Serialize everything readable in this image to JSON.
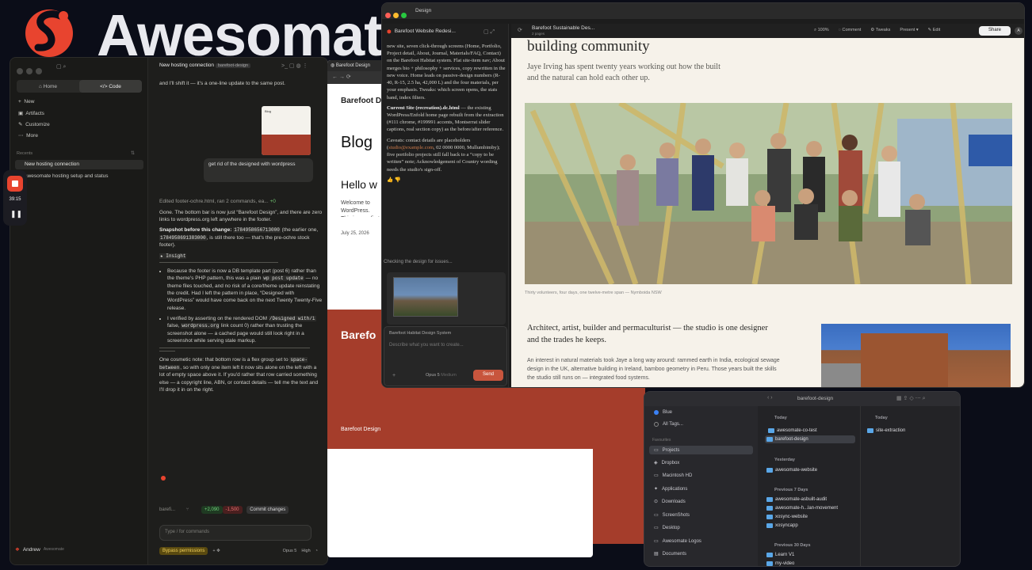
{
  "brand": {
    "logo_text": "Awesomat"
  },
  "claude": {
    "mode_tabs": [
      "Home",
      "Code"
    ],
    "nav": [
      "New",
      "Artifacts",
      "Customize",
      "More"
    ],
    "recents_label": "Recents",
    "recents": [
      "New hosting connection",
      "awesomate hosting setup and status"
    ],
    "title": "New hosting connection",
    "title_badge": "barefoot-design",
    "intro": "and I'll shift it — it's a one-line update to the same post.",
    "user_bubble": "get rid of the designed with wordpress",
    "action_line": "Edited footer-ochre.html, ran 2 commands, ea...",
    "action_plus": "+0",
    "gone_text": "Gone. The bottom bar is now just “Barefoot Design”, and there are zero links to wordpress.org left anywhere in the footer.",
    "snapshot_label": "Snapshot before this change:",
    "snapshot_id": "1784958656713000",
    "snapshot_mid": "(the earlier one,",
    "snapshot_id2": "1784958691383000",
    "snapshot_tail": ", is still there too — that's the pre-ochre stock footer).",
    "insight_label": "★ Insight",
    "bullet1a": "Because the footer is now a DB template part (post 6) rather than the theme's PHP pattern, this was a plain",
    "bullet1_code": "wp post update",
    "bullet1b": "— no theme files touched, and no risk of a core/theme update reinstating the credit. Had I left the pattern in place, “Designed with WordPress” would have come back on the next Twenty Twenty-Five release.",
    "bullet2a": "I verified by asserting on the rendered DOM",
    "bullet2_code1": "/Designed with/i",
    "bullet2b": "false,",
    "bullet2_code2": "wordpress.org",
    "bullet2c": "link count 0) rather than trusting the screenshot alone — a cached page would still look right in a screenshot while serving stale markup.",
    "cosmetic_a": "One cosmetic note: that bottom row is a flex group set to",
    "cosmetic_code": "space-between",
    "cosmetic_b": ", so with only one item left it now sits alone on the left with a lot of empty space above it. If you'd rather that row carried something else — a copyright line, ABN, or contact details — tell me the text and I'll drop it in on the right.",
    "branch": "barefi...",
    "diff_add": "+2,090",
    "diff_del": "-1,500",
    "commit_btn": "Commit changes",
    "input_placeholder": "Type / for commands",
    "bypass": "Bypass permissions",
    "model": "Opus 5",
    "effort": "High",
    "user_name": "Andrew",
    "user_plan": "Awesomate",
    "thumb_title": "Blog"
  },
  "recorder": {
    "time": "39:15"
  },
  "browser": {
    "tab": "Barefoot Design",
    "site_name": "Barefoot De",
    "heading": "Blog",
    "post_title": "Hello w",
    "post_excerpt": "Welcome to WordPress. This is your first post. Edit or delete it, then start writing!",
    "post_date": "July 25, 2026",
    "footer_brand": "Barefo",
    "footer_small": "Barefoot Design"
  },
  "design_app": {
    "window_title": "Design",
    "project_name": "Barefoot Website Redesi...",
    "file_name": "Barefoot Sustainable Des...",
    "file_sub": "2 pages",
    "zoom": "100%",
    "toolbar": [
      "Comment",
      "Tweaks",
      "Present",
      "Edit"
    ],
    "share": "Share",
    "avatar": "A",
    "left_text_1": "new site, seven click-through screens (Home, Portfolio, Project detail, About, Journal, Materials/FAQ, Contact) on the Barefoot Habitat system. Flat site-item nav; About merges bio + philosophy + services, copy rewritten in the new voice. Home leads on passive-design numbers (R-40, R-15, 2.5 ha, 42,000 L) and the four materials, per your emphasis. Tweaks: which screen opens, the stats band, index filters.",
    "left_bold_2": "Current Site (recreation).dc.html",
    "left_text_2": "— the existing WordPress/Enfold home page rebuilt from the extraction (#111 chrome, #199991 accents, Montserrat slider captions, real section copy) as the before/after reference.",
    "left_text_3a": "Caveats: contact details are placeholders (",
    "left_link": "studio@example.com",
    "left_text_3b": ", 02 0000 0000, Mullumbimby); five portfolio projects still fall back to a “copy to be written” note; Acknowledgement of Country wording needs the studio's sign-off.",
    "checking": "Checking the design for issues...",
    "system_label": "Barefoot Habitat Design System",
    "prompt_placeholder": "Describe what you want to create...",
    "model": "Opus 5",
    "model_sub": "Medium",
    "send": "Send",
    "canvas_heading": "building community",
    "canvas_intro": "Jaye Irving has spent twenty years working out how the built and the natural can hold each other up.",
    "photo_caption": "Thirty volunteers, four days, one twelve-metre span — Nymboida NSW",
    "section_heading": "Architect, artist, builder and permaculturist — the studio is one designer and the trades he keeps.",
    "section_body": "An interest in natural materials took Jaye a long way around: rammed earth in India, ecological sewage design in the UK, alternative building in Ireland, bamboo geometry in Peru. Those years built the skills the studio still runs on — integrated food systems."
  },
  "finder": {
    "path": "barefoot-design",
    "sidebar": [
      "Blue",
      "All Tags...",
      "Favourites",
      "Projects",
      "Dropbox",
      "Macintosh HD",
      "Applications",
      "Downloads",
      "ScreenShots",
      "Desktop",
      "Awesomate Logos",
      "Documents"
    ],
    "col1_today_label": "Today",
    "col1_today": [
      "awesomate-co-test",
      "barefoot-design"
    ],
    "col1_yesterday_label": "Yesterday",
    "col1_yesterday": [
      "awesomate-website"
    ],
    "col1_prev7_label": "Previous 7 Days",
    "col1_prev7": [
      "awesomate-asbuilt-audit",
      "awesomate-h...lan-movement",
      "xosync-website",
      "xosyncapp"
    ],
    "col1_prev30_label": "Previous 30 Days",
    "col1_prev30": [
      "Learn V1",
      "my-video"
    ],
    "col2_today_label": "Today",
    "col2_today": [
      "site-extraction"
    ]
  },
  "colors": {
    "rust": "#a53d2b",
    "accent": "#cc7a4a",
    "logo": "#e8442f",
    "folder": "#5aa7e8"
  }
}
